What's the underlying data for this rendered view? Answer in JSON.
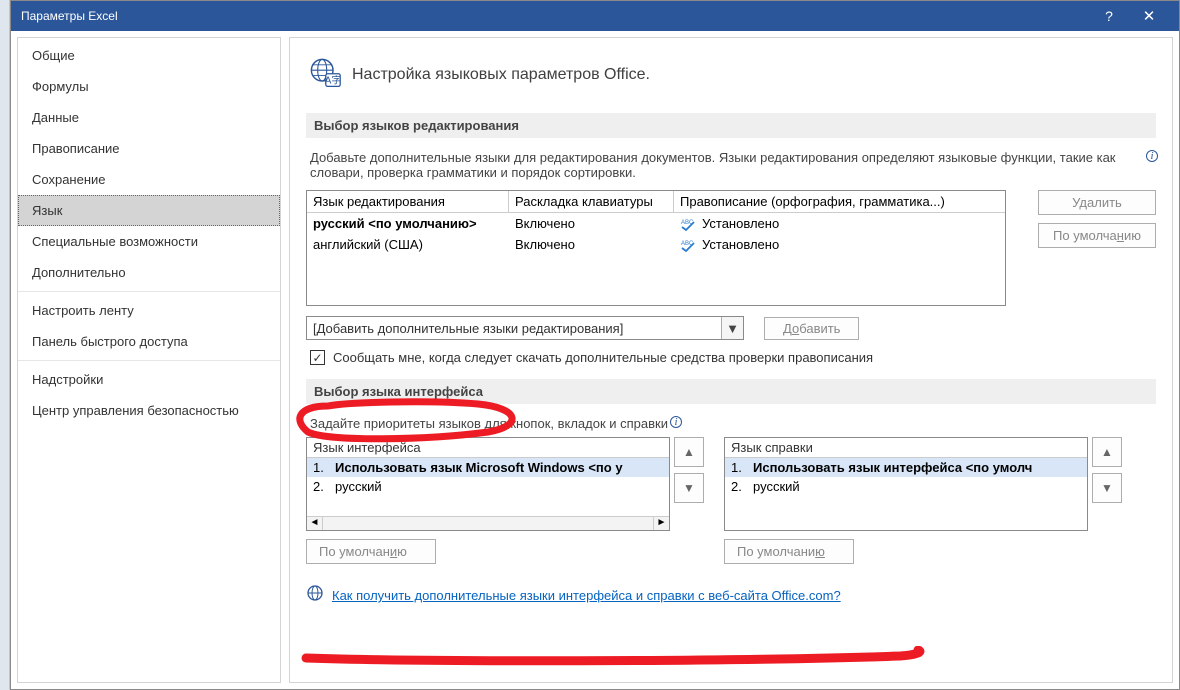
{
  "window": {
    "title": "Параметры Excel",
    "help": "?",
    "close": "✕"
  },
  "sidebar": {
    "items": [
      {
        "label": "Общие"
      },
      {
        "label": "Формулы"
      },
      {
        "label": "Данные"
      },
      {
        "label": "Правописание"
      },
      {
        "label": "Сохранение"
      },
      {
        "label": "Язык"
      },
      {
        "label": "Специальные возможности"
      },
      {
        "label": "Дополнительно"
      },
      {
        "label": "Настроить ленту"
      },
      {
        "label": "Панель быстрого доступа"
      },
      {
        "label": "Надстройки"
      },
      {
        "label": "Центр управления безопасностью"
      }
    ],
    "selected_index": 5
  },
  "page": {
    "title": "Настройка языковых параметров Office."
  },
  "edit_section": {
    "header": "Выбор языков редактирования",
    "description": "Добавьте дополнительные языки для редактирования документов. Языки редактирования определяют языковые функции, такие как словари, проверка грамматики и порядок сортировки.",
    "columns": {
      "lang": "Язык редактирования",
      "kb": "Раскладка клавиатуры",
      "sp": "Правописание (орфография, грамматика...)"
    },
    "rows": [
      {
        "lang": "русский <по умолчанию>",
        "kb": "Включено",
        "sp": "Установлено",
        "bold": true
      },
      {
        "lang": "английский (США)",
        "kb": "Включено",
        "sp": "Установлено",
        "bold": false
      }
    ],
    "delete_btn": "Удалить",
    "default_btn_pre": "По умолча",
    "default_btn_ul": "н",
    "default_btn_post": "ию",
    "add_combo": "[Добавить дополнительные языки редактирования]",
    "add_btn_pre": "Д",
    "add_btn_ul": "о",
    "add_btn_post": "бавить",
    "checkbox": "Сообщать мне, когда следует скачать дополнительные средства проверки правописания"
  },
  "ui_section": {
    "header": "Выбор языка интерфейса",
    "description": "Задайте приоритеты языков для кнопок, вкладок и справки",
    "left": {
      "title": "Язык интерфейса",
      "rows": [
        {
          "n": "1.",
          "t": "Использовать язык Microsoft Windows <по у"
        },
        {
          "n": "2.",
          "t": "русский"
        }
      ],
      "default_pre": "По умолчан",
      "default_ul": "и",
      "default_post": "ю"
    },
    "right": {
      "title": "Язык справки",
      "rows": [
        {
          "n": "1.",
          "t": "Использовать язык интерфейса <по умолч"
        },
        {
          "n": "2.",
          "t": "русский"
        }
      ],
      "default_pre": "По умолчани",
      "default_ul": "ю",
      "default_post": ""
    },
    "link": "Как получить дополнительные языки интерфейса и справки с веб-сайта Office.com?"
  }
}
